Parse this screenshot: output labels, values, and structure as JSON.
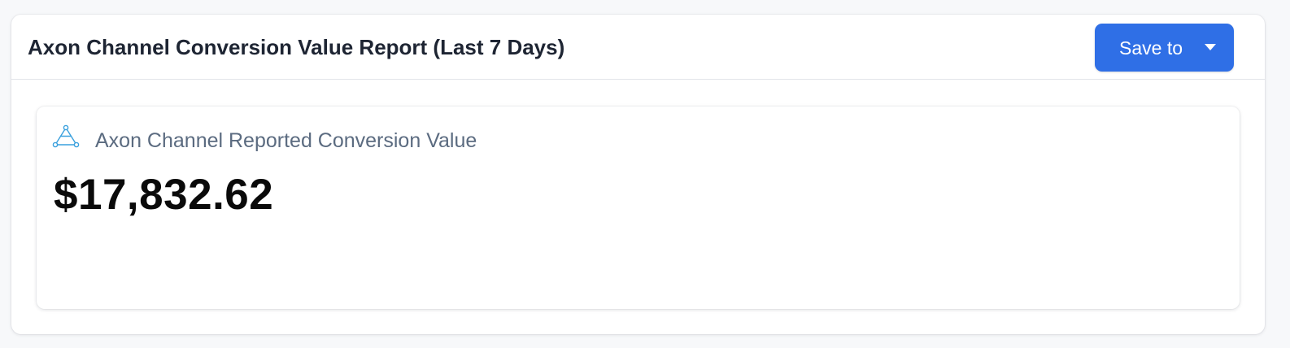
{
  "report": {
    "title": "Axon Channel Conversion Value Report (Last 7 Days)",
    "save_label": "Save to"
  },
  "metric": {
    "icon": "axon-logo-icon",
    "label": "Axon Channel Reported Conversion Value",
    "value": "$17,832.62"
  },
  "colors": {
    "accent": "#2f6fe6",
    "icon": "#3aa0dd"
  }
}
